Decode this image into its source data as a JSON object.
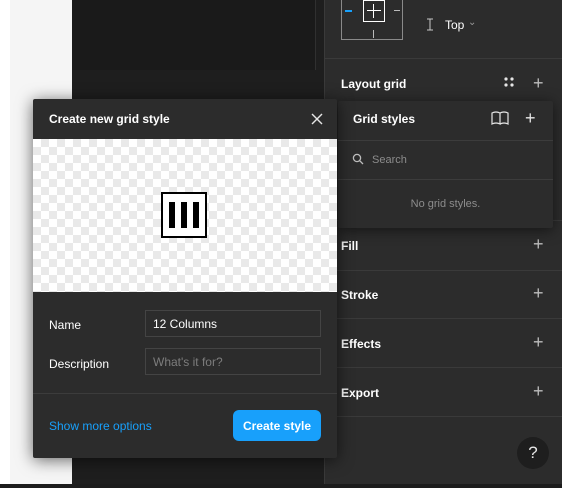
{
  "constraints": {
    "vertical_value": "Top"
  },
  "right_panel": {
    "layout_grid_label": "Layout grid",
    "fill_label": "Fill",
    "stroke_label": "Stroke",
    "effects_label": "Effects",
    "export_label": "Export",
    "plus_glyph": "+"
  },
  "grid_styles_popup": {
    "title": "Grid styles",
    "search_placeholder": "Search",
    "empty_text": "No grid styles."
  },
  "create_modal": {
    "title": "Create new grid style",
    "name_label": "Name",
    "name_value": "12 Columns",
    "description_label": "Description",
    "description_placeholder": "What's it for?",
    "show_more_label": "Show more options",
    "create_button_label": "Create style"
  },
  "help": {
    "label": "?"
  },
  "colors": {
    "accent": "#18a0fb",
    "panel_bg": "#2c2c2c",
    "canvas_bg": "#1e1e1e"
  }
}
